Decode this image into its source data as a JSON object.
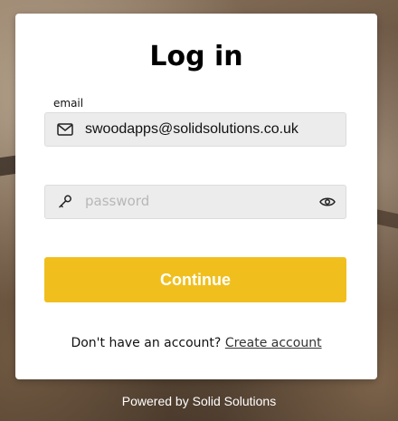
{
  "title": "Log in",
  "email": {
    "label": "email",
    "value": "swoodapps@solidsolutions.co.uk",
    "icon": "mail-icon"
  },
  "password": {
    "placeholder": "password",
    "value": "",
    "icon": "key-icon",
    "toggle_icon": "eye-icon"
  },
  "continue_label": "Continue",
  "signup": {
    "prompt": "Don't have an account?",
    "link": "Create account"
  },
  "footer": "Powered by Solid Solutions",
  "colors": {
    "accent": "#f0bf1e",
    "field_bg": "#ececec"
  }
}
